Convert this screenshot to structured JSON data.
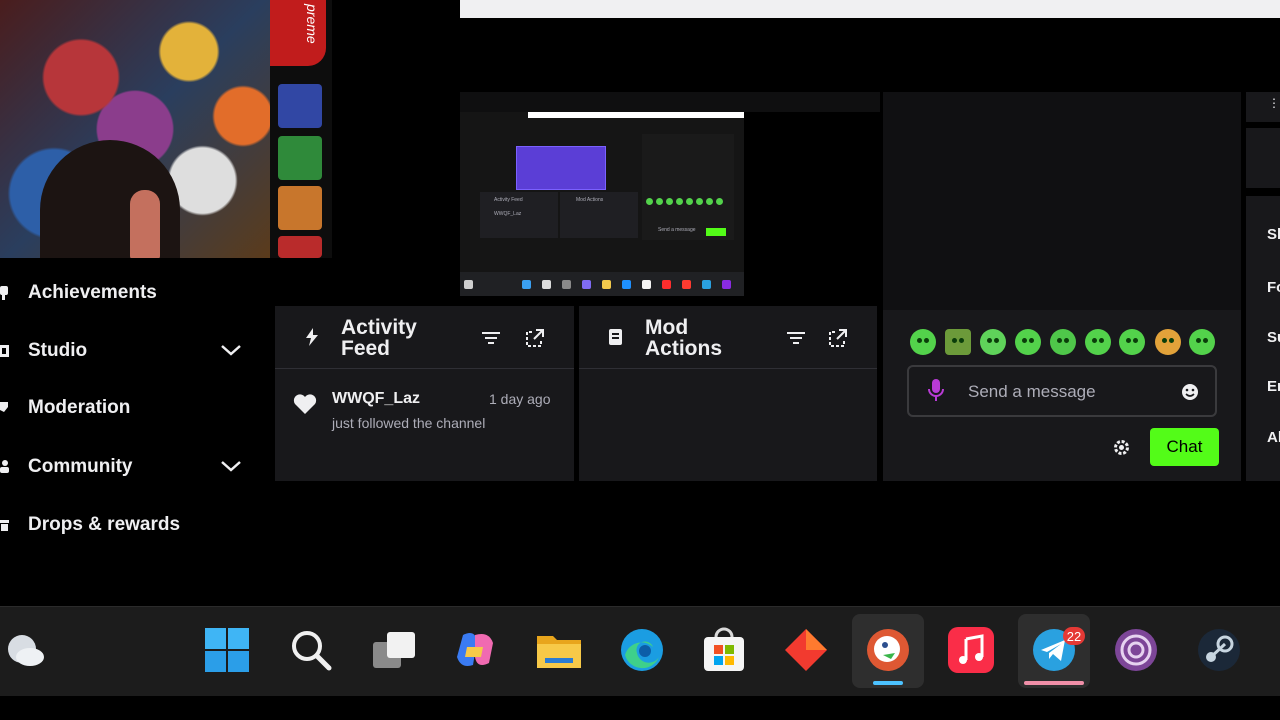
{
  "nav": {
    "items": [
      {
        "label": "Achievements"
      },
      {
        "label": "Studio"
      },
      {
        "label": "Moderation"
      },
      {
        "label": "Community"
      },
      {
        "label": "Drops & rewards"
      }
    ]
  },
  "activity_feed": {
    "title_line1": "Activity",
    "title_line2": "Feed",
    "events": [
      {
        "user": "WWQF_Laz",
        "description": "just followed the channel",
        "time": "1 day ago"
      }
    ]
  },
  "mod_actions": {
    "title_line1": "Mod",
    "title_line2": "Actions"
  },
  "chat": {
    "placeholder": "Send a message",
    "send_label": "Chat",
    "accent_color": "#53fc18"
  },
  "right_sidebar": {
    "labels": [
      "Sh",
      "Fo",
      "Su",
      "En",
      "Al"
    ]
  },
  "taskbar": {
    "telegram_badge": "22",
    "apps": [
      "weather",
      "start",
      "search",
      "task-view",
      "copilot",
      "file-explorer",
      "edge",
      "microsoft-store",
      "app-red",
      "duckduckgo",
      "apple-music",
      "telegram",
      "tor-browser",
      "steam"
    ]
  },
  "webcam_overlay": {
    "can_text": "preme"
  },
  "preview": {
    "panel1_title": "Activity Feed",
    "panel1_user": "WWQF_Laz",
    "panel2_title": "Mod Actions",
    "chat_placeholder": "Send a message"
  }
}
